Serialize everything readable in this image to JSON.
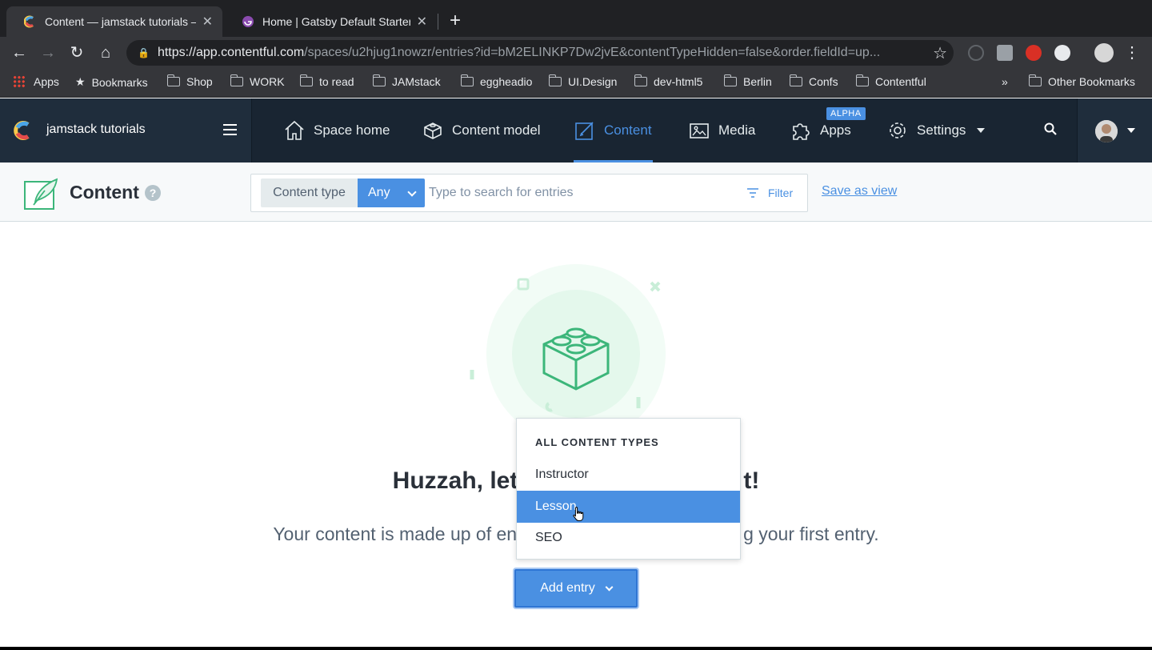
{
  "browser": {
    "tabs": [
      {
        "title": "Content — jamstack tutorials – ",
        "active": true
      },
      {
        "title": "Home | Gatsby Default Starter",
        "active": false
      }
    ],
    "url_host": "https://app.contentful.com",
    "url_path": "/spaces/u2hjug1nowzr/entries?id=bM2ELINKP7Dw2jvE&contentTypeHidden=false&order.fieldId=up...",
    "bookmarks": [
      "Apps",
      "Bookmarks",
      "Shop",
      "WORK",
      "to read",
      "JAMstack",
      "eggheadio",
      "UI.Design",
      "dev-html5",
      "Berlin",
      "Confs",
      "Contentful"
    ],
    "overflow": "»",
    "other_bookmarks": "Other Bookmarks"
  },
  "app": {
    "space_name": "jamstack tutorials",
    "nav": [
      {
        "label": "Space home",
        "icon": "home-icon"
      },
      {
        "label": "Content model",
        "icon": "cube-icon"
      },
      {
        "label": "Content",
        "icon": "pen-icon",
        "active": true
      },
      {
        "label": "Media",
        "icon": "image-icon"
      },
      {
        "label": "Apps",
        "icon": "puzzle-icon"
      },
      {
        "label": "Settings",
        "icon": "gear-icon"
      }
    ],
    "apps_badge": "ALPHA",
    "accent": "#4a90e2"
  },
  "header": {
    "title": "Content",
    "help": "?",
    "content_type_label": "Content type",
    "content_type_value": "Any",
    "search_placeholder": "Type to search for entries",
    "filter_label": "Filter",
    "save_view": "Save as view"
  },
  "empty_state": {
    "title": "Huzzah, let's create your first entry!",
    "title_visible_left": "Huzzah, let",
    "title_visible_right": "t!",
    "subtitle_visible_left": "Your content is made up of en",
    "subtitle_visible_right": "g your first entry.",
    "add_entry": "Add entry"
  },
  "dropdown": {
    "header": "ALL CONTENT TYPES",
    "options": [
      "Instructor",
      "Lesson",
      "SEO"
    ],
    "selected": "Lesson"
  }
}
